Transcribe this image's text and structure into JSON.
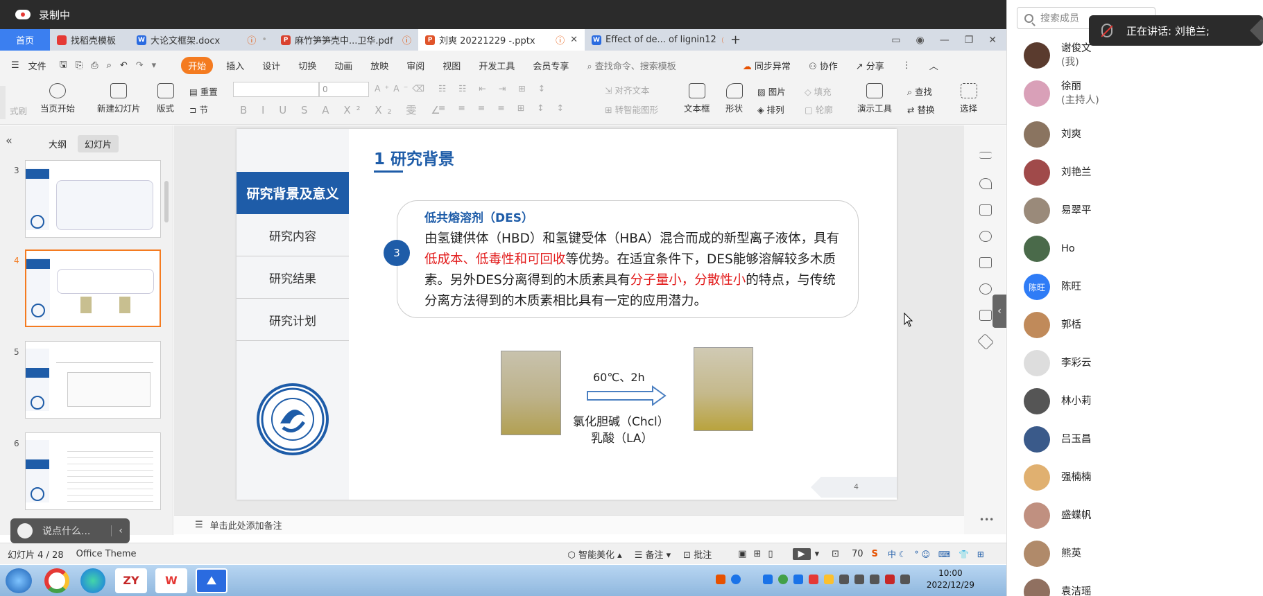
{
  "recording": {
    "label": "录制中"
  },
  "tabs": {
    "home": "首页",
    "items": [
      {
        "label": "找稻壳模板",
        "color": "#e53935"
      },
      {
        "label": "大论文框架.docx",
        "color": "#2a6be0"
      },
      {
        "label": "麻竹笋笋壳中...卫华.pdf",
        "color": "#d9412e"
      },
      {
        "label": "刘爽 20221229 -.pptx",
        "color": "#e0542a"
      },
      {
        "label": "Effect of de... of lignin12",
        "color": "#2a6be0"
      }
    ],
    "add": "+"
  },
  "menu": {
    "file": "文件",
    "items": [
      "开始",
      "插入",
      "设计",
      "切换",
      "动画",
      "放映",
      "审阅",
      "视图",
      "开发工具",
      "会员专享"
    ],
    "search": "查找命令、搜索模板",
    "sync": "同步异常",
    "collab": "协作",
    "share": "分享"
  },
  "ribbon": {
    "play_from_current": "当页开始",
    "new_slide": "新建幻灯片",
    "layout": "版式",
    "section": "节",
    "reset": "重置",
    "font_size": "0",
    "align_text": "对齐文本",
    "smartart": "转智能图形",
    "textbox": "文本框",
    "shape": "形状",
    "picture": "图片",
    "arrange": "排列",
    "fill": "填充",
    "outline": "轮廓",
    "present_tools": "演示工具",
    "find": "查找",
    "replace": "替换",
    "select": "选择",
    "cut_fragment": "式刷"
  },
  "leftpanel": {
    "outline_tab": "大纲",
    "slides_tab": "幻灯片",
    "thumbs": [
      "3",
      "4",
      "5",
      "6"
    ]
  },
  "slide": {
    "nav": [
      "研究背景及意义",
      "研究内容",
      "研究结果",
      "研究计划"
    ],
    "title": "1  研究背景",
    "bullet_num": "3",
    "subtitle": "低共熔溶剂（DES）",
    "body_1": "由氢键供体（HBD）和氢键受体（HBA）混合而成的新型离子液体，具有",
    "body_red_1": "低成本、低毒性和可回收",
    "body_2": "等优势。在适宜条件下，DES能够溶解较多木质素。另外DES分离得到的木质素具有",
    "body_red_2": "分子量小，分散性小",
    "body_3": "的特点，与传统分离方法得到的木质素相比具有一定的应用潜力。",
    "condition": "60℃、2h",
    "reagent_1": "氯化胆碱（Chcl）",
    "reagent_2": "乳酸（LA）",
    "page": "4"
  },
  "notes": {
    "placeholder": "单击此处添加备注"
  },
  "chat": {
    "placeholder": "说点什么..."
  },
  "status": {
    "slide_count": "幻灯片 4 / 28",
    "theme": "Office Theme",
    "beautify": "智能美化",
    "notes": "备注",
    "comments": "批注",
    "zoom": "70"
  },
  "taskbar": {
    "time": "10:00",
    "date": "2022/12/29"
  },
  "participants": {
    "search_placeholder": "搜索成员",
    "speaking": "正在讲话: 刘艳兰;",
    "list": [
      {
        "name": "谢俊文",
        "role": "(我)",
        "color": "#5a3b2e"
      },
      {
        "name": "徐丽",
        "role": "(主持人)",
        "color": "#d9a0b8"
      },
      {
        "name": "刘爽",
        "role": "",
        "color": "#8a7460"
      },
      {
        "name": "刘艳兰",
        "role": "",
        "color": "#a04a4a"
      },
      {
        "name": "易翠平",
        "role": "",
        "color": "#9a8a7a"
      },
      {
        "name": "Ho",
        "role": "",
        "color": "#4a6a4a"
      },
      {
        "name": "陈旺",
        "role": "",
        "color": "#2f7cf6",
        "initials": "陈旺"
      },
      {
        "name": "郭栝",
        "role": "",
        "color": "#c08a5a"
      },
      {
        "name": "李彩云",
        "role": "",
        "color": "#dddddd"
      },
      {
        "name": "林小莉",
        "role": "",
        "color": "#555555"
      },
      {
        "name": "吕玉昌",
        "role": "",
        "color": "#3a5a8a"
      },
      {
        "name": "强楠楠",
        "role": "",
        "color": "#e0b070"
      },
      {
        "name": "盛蝶帆",
        "role": "",
        "color": "#c09080"
      },
      {
        "name": "熊英",
        "role": "",
        "color": "#b08a6a"
      },
      {
        "name": "袁洁瑶",
        "role": "",
        "color": "#907060"
      }
    ]
  }
}
